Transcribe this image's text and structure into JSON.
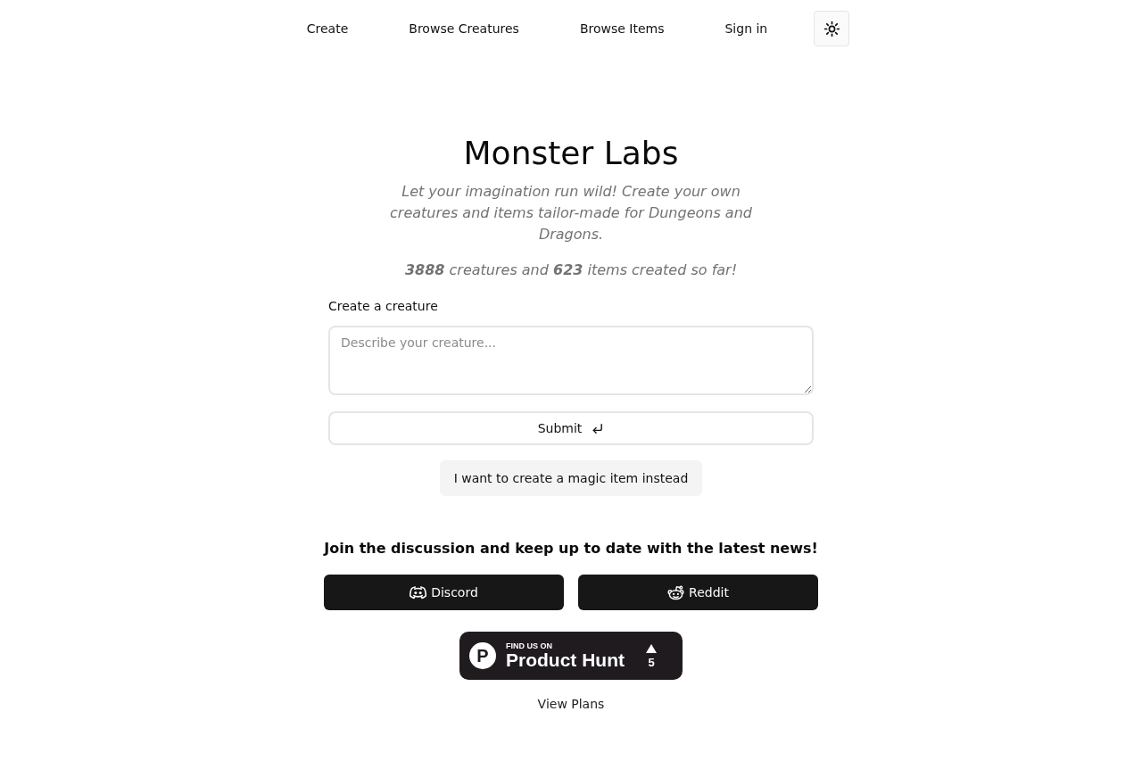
{
  "nav": {
    "links": [
      {
        "label": "Create"
      },
      {
        "label": "Browse Creatures"
      },
      {
        "label": "Browse Items"
      }
    ],
    "sign_in": "Sign in"
  },
  "hero": {
    "title": "Monster Labs",
    "tagline": "Let your imagination run wild! Create your own creatures and items tailor-made for Dungeons and Dragons.",
    "stats": "**3888** creatures and **623** items created so far!"
  },
  "creature_form": {
    "label": "Create a creature",
    "placeholder": "Describe your creature...",
    "submit": "Submit",
    "switch_mode": "I want to create a magic item instead"
  },
  "community": {
    "heading": "Join the discussion and keep up to date with the latest news!",
    "buttons": [
      {
        "kind": "discord",
        "label": "Discord"
      },
      {
        "kind": "reddit",
        "label": "Reddit"
      }
    ]
  },
  "product_hunt": {
    "logo_letter": "P",
    "eyebrow": "FIND US ON",
    "name": "Product Hunt",
    "votes": "5"
  },
  "footer_link": "View Plans"
}
